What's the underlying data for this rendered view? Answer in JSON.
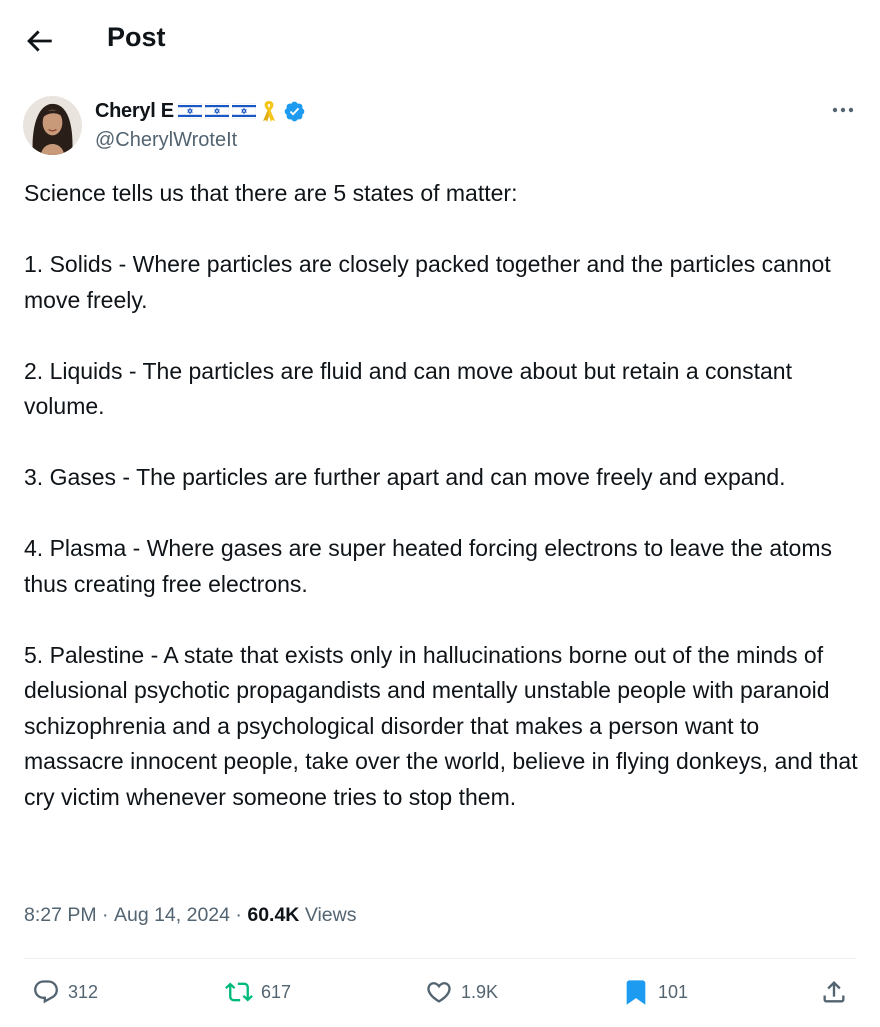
{
  "header": {
    "title": "Post"
  },
  "author": {
    "display_name": "Cheryl E",
    "handle": "@CherylWroteIt"
  },
  "post": {
    "text": "Science tells us that there are 5 states of matter:\n\n1. Solids - Where particles are closely packed together and the particles cannot move freely.\n\n2. Liquids - The particles are fluid and can move about but retain a constant volume.\n\n3. Gases - The particles are further apart and can move freely and expand.\n\n4. Plasma - Where gases are super heated forcing electrons to leave the atoms thus creating free electrons.\n\n5. Palestine - A state that exists only in hallucinations borne out of the minds of delusional psychotic propagandists and mentally unstable people with paranoid schizophrenia and a psychological disorder that makes a person want to massacre innocent people, take over the world, believe in flying donkeys, and that cry victim whenever someone tries to stop them.",
    "time": "8:27 PM",
    "date": "Aug 14, 2024",
    "separator": " · ",
    "views_count": "60.4K",
    "views_label": "Views"
  },
  "actions": {
    "replies": "312",
    "reposts": "617",
    "likes": "1.9K",
    "bookmarks": "101"
  },
  "colors": {
    "text": "#0f1419",
    "secondary": "#536471",
    "verified": "#1d9bf0",
    "repost_green": "#00ba7c",
    "bookmark_blue": "#1d9bf0",
    "ribbon_yellow": "#f5c518"
  },
  "icons": [
    "back-arrow-icon",
    "israel-flag-icon",
    "yellow-ribbon-icon",
    "verified-badge-icon",
    "more-icon",
    "reply-icon",
    "repost-icon",
    "like-icon",
    "bookmark-icon",
    "share-icon"
  ]
}
